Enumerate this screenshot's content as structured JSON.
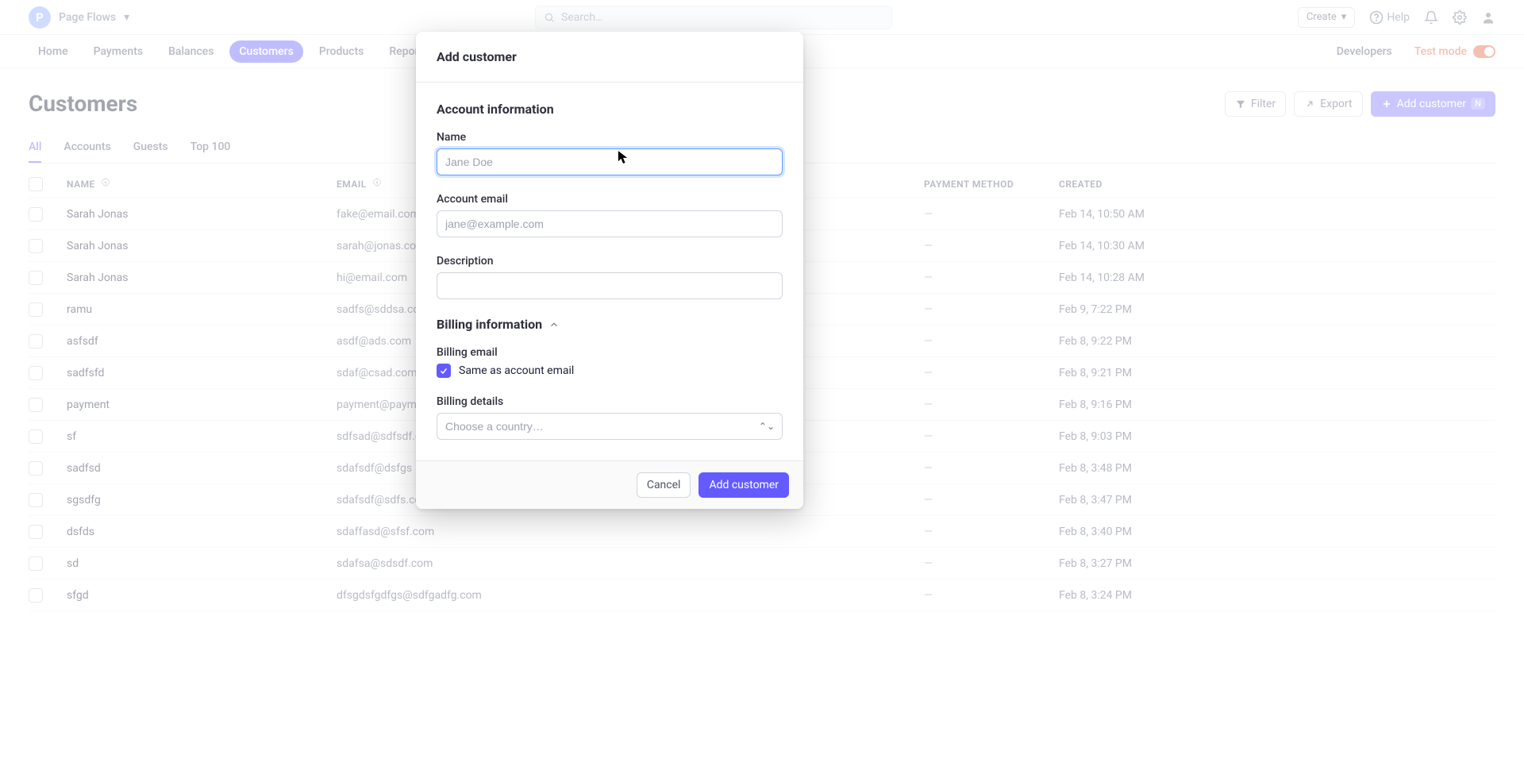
{
  "brand": {
    "name": "Page Flows",
    "initial": "P"
  },
  "search": {
    "placeholder": "Search…"
  },
  "topbar": {
    "create": "Create",
    "help": "Help"
  },
  "nav": {
    "items": [
      "Home",
      "Payments",
      "Balances",
      "Customers",
      "Products",
      "Reports"
    ],
    "active_index": 3,
    "developers": "Developers",
    "testmode": "Test mode"
  },
  "page": {
    "title": "Customers",
    "actions": {
      "filter": "Filter",
      "export": "Export",
      "add": "Add customer",
      "kbd": "N"
    }
  },
  "tabs": {
    "items": [
      "All",
      "Accounts",
      "Guests",
      "Top 100"
    ],
    "active_index": 0
  },
  "table": {
    "columns": [
      "NAME",
      "EMAIL",
      "PAYMENT METHOD",
      "CREATED"
    ],
    "rows": [
      {
        "name": "Sarah Jonas",
        "email": "fake@email.com",
        "pay": "—",
        "created": "Feb 14, 10:50 AM"
      },
      {
        "name": "Sarah Jonas",
        "email": "sarah@jonas.com",
        "pay": "—",
        "created": "Feb 14, 10:30 AM"
      },
      {
        "name": "Sarah Jonas",
        "email": "hi@email.com",
        "pay": "—",
        "created": "Feb 14, 10:28 AM"
      },
      {
        "name": "ramu",
        "email": "sadfs@sddsa.com",
        "pay": "—",
        "created": "Feb 9, 7:22 PM"
      },
      {
        "name": "asfsdf",
        "email": "asdf@ads.com",
        "pay": "—",
        "created": "Feb 8, 9:22 PM"
      },
      {
        "name": "sadfsfd",
        "email": "sdaf@csad.com",
        "pay": "—",
        "created": "Feb 8, 9:21 PM"
      },
      {
        "name": "payment",
        "email": "payment@paym",
        "pay": "—",
        "created": "Feb 8, 9:16 PM"
      },
      {
        "name": "sf",
        "email": "sdfsad@sdfsdf.com",
        "pay": "—",
        "created": "Feb 8, 9:03 PM"
      },
      {
        "name": "sadfsd",
        "email": "sdafsdf@dsfgs",
        "pay": "—",
        "created": "Feb 8, 3:48 PM"
      },
      {
        "name": "sgsdfg",
        "email": "sdafsdf@sdfs.com",
        "pay": "—",
        "created": "Feb 8, 3:47 PM"
      },
      {
        "name": "dsfds",
        "email": "sdaffasd@sfsf.com",
        "pay": "—",
        "created": "Feb 8, 3:40 PM"
      },
      {
        "name": "sd",
        "email": "sdafsa@sdsdf.com",
        "pay": "—",
        "created": "Feb 8, 3:27 PM"
      },
      {
        "name": "sfgd",
        "email": "dfsgdsfgdfgs@sdfgadfg.com",
        "pay": "—",
        "created": "Feb 8, 3:24 PM"
      }
    ]
  },
  "modal": {
    "title": "Add customer",
    "account": {
      "heading": "Account information",
      "name_label": "Name",
      "name_placeholder": "Jane Doe",
      "email_label": "Account email",
      "email_placeholder": "jane@example.com",
      "desc_label": "Description"
    },
    "billing": {
      "heading": "Billing information",
      "email_label": "Billing email",
      "same_label": "Same as account email",
      "details_label": "Billing details",
      "country_placeholder": "Choose a country…"
    },
    "footer": {
      "cancel": "Cancel",
      "submit": "Add customer"
    }
  }
}
